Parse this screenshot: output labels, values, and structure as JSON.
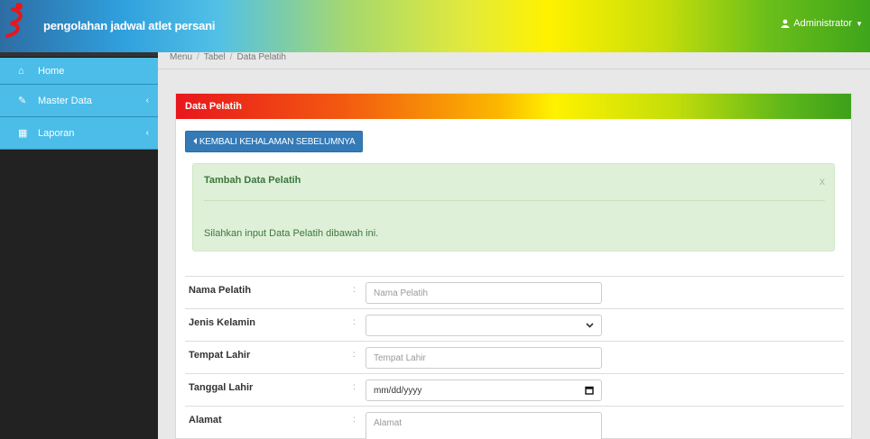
{
  "app": {
    "title": "pengolahan jadwal atlet persani",
    "user": "Administrator"
  },
  "sidebar": {
    "items": [
      {
        "label": "Home",
        "icon": "home-icon"
      },
      {
        "label": "Master Data",
        "icon": "edit-icon"
      },
      {
        "label": "Laporan",
        "icon": "calendar-icon"
      }
    ]
  },
  "breadcrumb": [
    "Menu",
    "Tabel",
    "Data Pelatih"
  ],
  "panel": {
    "title": "Data Pelatih",
    "back_label": "KEMBALI KEHALAMAN SEBELUMNYA"
  },
  "alert": {
    "title": "Tambah Data Pelatih",
    "close": "x",
    "message": "Silahkan input Data Pelatih dibawah ini."
  },
  "form": {
    "colon": ":",
    "fields": [
      {
        "label": "Nama Pelatih",
        "placeholder": "Nama Pelatih"
      },
      {
        "label": "Jenis Kelamin",
        "value": ""
      },
      {
        "label": "Tempat Lahir",
        "placeholder": "Tempat Lahir"
      },
      {
        "label": "Tanggal Lahir",
        "value": "mm/dd/yyyy"
      },
      {
        "label": "Alamat",
        "placeholder": "Alamat"
      }
    ]
  },
  "colors": {
    "primary": "#337ab7",
    "sidebar_item": "#4bbde8",
    "alert_bg": "#dff0d8"
  }
}
